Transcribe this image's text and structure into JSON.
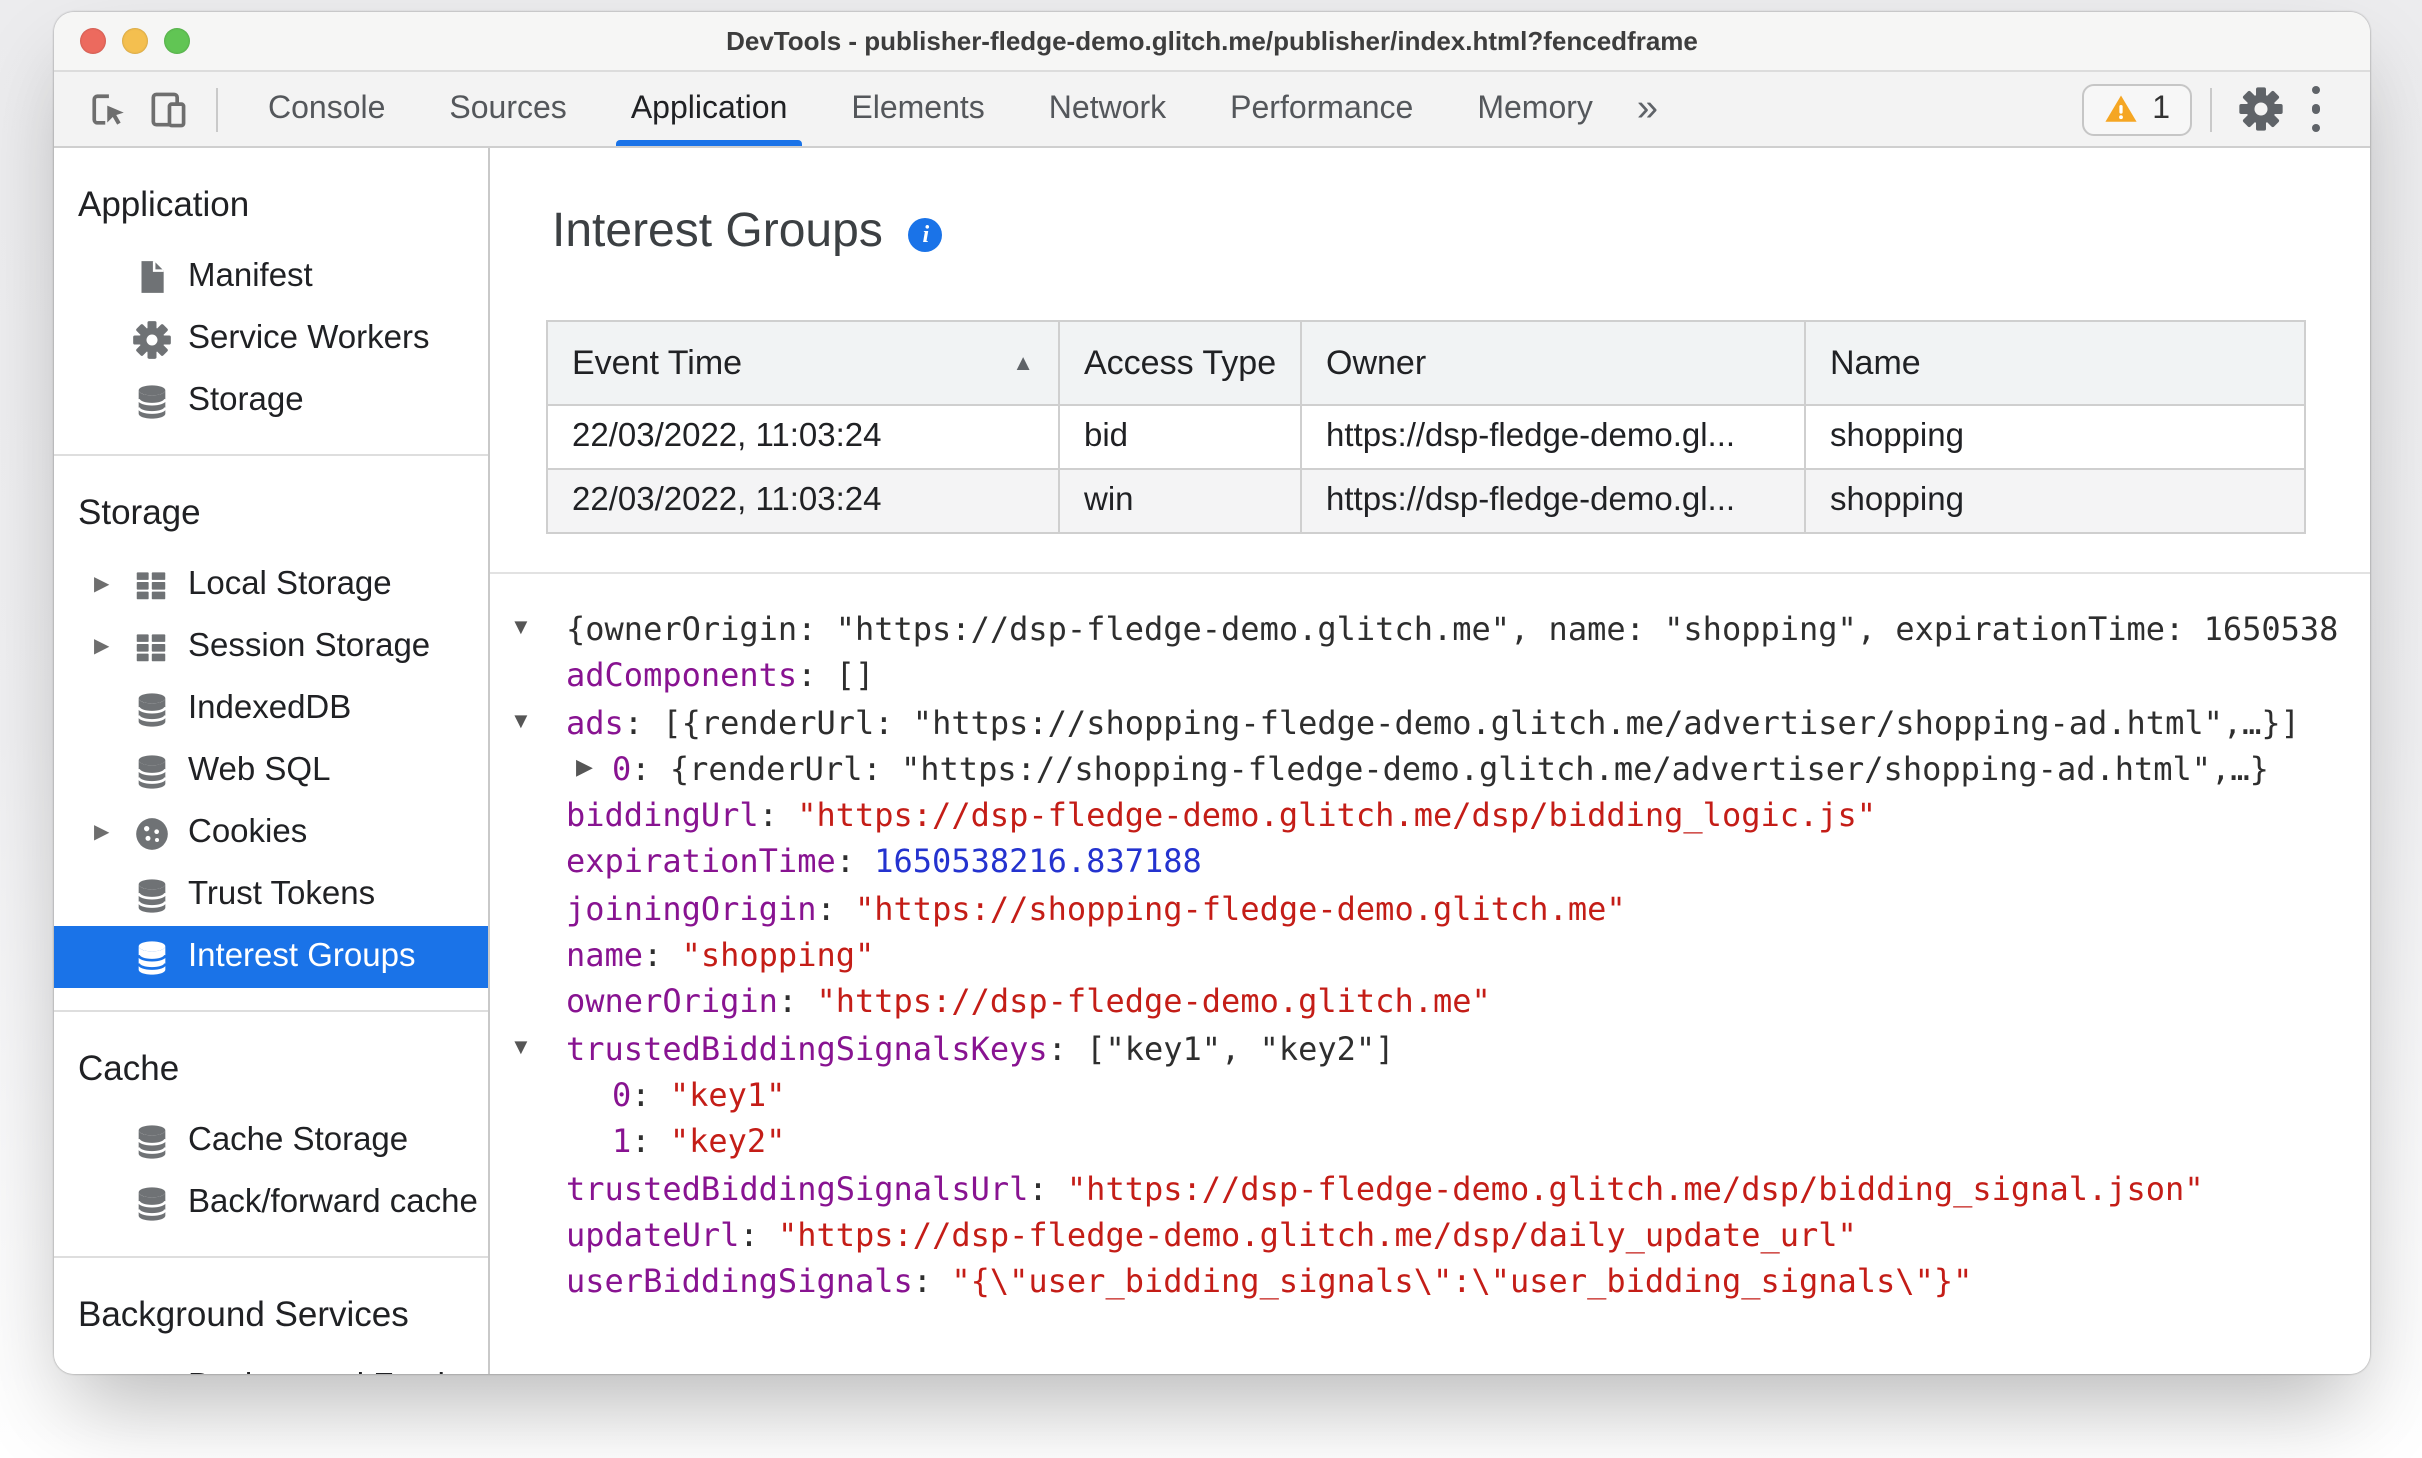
{
  "colors": {
    "accent": "#1a73e8",
    "key": "#881391",
    "string": "#c41d17",
    "number": "#2433cf",
    "warning": "#f5a623",
    "traffic_close": "#ec6a5e",
    "traffic_minimize": "#f4bf4f",
    "traffic_zoom": "#61c554"
  },
  "window": {
    "title": "DevTools - publisher-fledge-demo.glitch.me/publisher/index.html?fencedframe"
  },
  "toolbar": {
    "inspect_icon": "inspect-icon",
    "device_icon": "device-toolbar-icon",
    "tabs": [
      {
        "label": "Console",
        "active": false
      },
      {
        "label": "Sources",
        "active": false
      },
      {
        "label": "Application",
        "active": true
      },
      {
        "label": "Elements",
        "active": false
      },
      {
        "label": "Network",
        "active": false
      },
      {
        "label": "Performance",
        "active": false
      },
      {
        "label": "Memory",
        "active": false
      }
    ],
    "more_tabs_glyph": "»",
    "warning_count": "1",
    "gear_icon": "gear-icon",
    "kebab_icon": "kebab-menu-icon"
  },
  "sidebar": {
    "sections": [
      {
        "title": "Application",
        "items": [
          {
            "label": "Manifest",
            "icon": "document-icon",
            "expandable": false,
            "selected": false
          },
          {
            "label": "Service Workers",
            "icon": "gear-icon",
            "expandable": false,
            "selected": false
          },
          {
            "label": "Storage",
            "icon": "database-icon",
            "expandable": false,
            "selected": false
          }
        ]
      },
      {
        "title": "Storage",
        "items": [
          {
            "label": "Local Storage",
            "icon": "table-icon",
            "expandable": true,
            "selected": false
          },
          {
            "label": "Session Storage",
            "icon": "table-icon",
            "expandable": true,
            "selected": false
          },
          {
            "label": "IndexedDB",
            "icon": "database-icon",
            "expandable": false,
            "selected": false
          },
          {
            "label": "Web SQL",
            "icon": "database-icon",
            "expandable": false,
            "selected": false
          },
          {
            "label": "Cookies",
            "icon": "cookie-icon",
            "expandable": true,
            "selected": false
          },
          {
            "label": "Trust Tokens",
            "icon": "database-icon",
            "expandable": false,
            "selected": false
          },
          {
            "label": "Interest Groups",
            "icon": "database-icon",
            "expandable": false,
            "selected": true
          }
        ]
      },
      {
        "title": "Cache",
        "items": [
          {
            "label": "Cache Storage",
            "icon": "database-icon",
            "expandable": false,
            "selected": false
          },
          {
            "label": "Back/forward cache",
            "icon": "database-icon",
            "expandable": false,
            "selected": false
          }
        ]
      },
      {
        "title": "Background Services",
        "items": [
          {
            "label": "Background Fetch",
            "icon": "fetch-icon",
            "expandable": false,
            "selected": false
          }
        ]
      }
    ]
  },
  "main": {
    "title": "Interest Groups",
    "info_icon_glyph": "i",
    "table": {
      "columns": [
        {
          "label": "Event Time",
          "sort": "asc"
        },
        {
          "label": "Access Type",
          "sort": null
        },
        {
          "label": "Owner",
          "sort": null
        },
        {
          "label": "Name",
          "sort": null
        }
      ],
      "sort_glyph": "▲",
      "rows": [
        [
          "22/03/2022, 11:03:24",
          "bid",
          "https://dsp-fledge-demo.gl...",
          "shopping"
        ],
        [
          "22/03/2022, 11:03:24",
          "win",
          "https://dsp-fledge-demo.gl...",
          "shopping"
        ]
      ]
    },
    "tree": {
      "open_glyph": "▼",
      "closed_glyph": "▶",
      "lines": [
        {
          "level": 1,
          "expander": "open",
          "segments": [
            {
              "c": "plain",
              "t": "{ownerOrigin: \"https://dsp-fledge-demo.glitch.me\", name: \"shopping\", expirationTime: 1650538"
            }
          ]
        },
        {
          "level": 1,
          "expander": "none",
          "segments": [
            {
              "c": "key",
              "t": "adComponents"
            },
            {
              "c": "plain",
              "t": ": []"
            }
          ]
        },
        {
          "level": 1,
          "expander": "open",
          "segments": [
            {
              "c": "key",
              "t": "ads"
            },
            {
              "c": "plain",
              "t": ": [{renderUrl: \"https://shopping-fledge-demo.glitch.me/advertiser/shopping-ad.html\",…}]"
            }
          ]
        },
        {
          "level": 2,
          "expander": "closed",
          "segments": [
            {
              "c": "key",
              "t": "0"
            },
            {
              "c": "plain",
              "t": ": {renderUrl: \"https://shopping-fledge-demo.glitch.me/advertiser/shopping-ad.html\",…}"
            }
          ]
        },
        {
          "level": 1,
          "expander": "none",
          "segments": [
            {
              "c": "key",
              "t": "biddingUrl"
            },
            {
              "c": "plain",
              "t": ": "
            },
            {
              "c": "str",
              "t": "\"https://dsp-fledge-demo.glitch.me/dsp/bidding_logic.js\""
            }
          ]
        },
        {
          "level": 1,
          "expander": "none",
          "segments": [
            {
              "c": "key",
              "t": "expirationTime"
            },
            {
              "c": "plain",
              "t": ": "
            },
            {
              "c": "num",
              "t": "1650538216.837188"
            }
          ]
        },
        {
          "level": 1,
          "expander": "none",
          "segments": [
            {
              "c": "key",
              "t": "joiningOrigin"
            },
            {
              "c": "plain",
              "t": ": "
            },
            {
              "c": "str",
              "t": "\"https://shopping-fledge-demo.glitch.me\""
            }
          ]
        },
        {
          "level": 1,
          "expander": "none",
          "segments": [
            {
              "c": "key",
              "t": "name"
            },
            {
              "c": "plain",
              "t": ": "
            },
            {
              "c": "str",
              "t": "\"shopping\""
            }
          ]
        },
        {
          "level": 1,
          "expander": "none",
          "segments": [
            {
              "c": "key",
              "t": "ownerOrigin"
            },
            {
              "c": "plain",
              "t": ": "
            },
            {
              "c": "str",
              "t": "\"https://dsp-fledge-demo.glitch.me\""
            }
          ]
        },
        {
          "level": 1,
          "expander": "open",
          "segments": [
            {
              "c": "key",
              "t": "trustedBiddingSignalsKeys"
            },
            {
              "c": "plain",
              "t": ": [\"key1\", \"key2\"]"
            }
          ]
        },
        {
          "level": 2,
          "expander": "none",
          "segments": [
            {
              "c": "key",
              "t": "0"
            },
            {
              "c": "plain",
              "t": ": "
            },
            {
              "c": "str",
              "t": "\"key1\""
            }
          ]
        },
        {
          "level": 2,
          "expander": "none",
          "segments": [
            {
              "c": "key",
              "t": "1"
            },
            {
              "c": "plain",
              "t": ": "
            },
            {
              "c": "str",
              "t": "\"key2\""
            }
          ]
        },
        {
          "level": 1,
          "expander": "none",
          "segments": [
            {
              "c": "key",
              "t": "trustedBiddingSignalsUrl"
            },
            {
              "c": "plain",
              "t": ": "
            },
            {
              "c": "str",
              "t": "\"https://dsp-fledge-demo.glitch.me/dsp/bidding_signal.json\""
            }
          ]
        },
        {
          "level": 1,
          "expander": "none",
          "segments": [
            {
              "c": "key",
              "t": "updateUrl"
            },
            {
              "c": "plain",
              "t": ": "
            },
            {
              "c": "str",
              "t": "\"https://dsp-fledge-demo.glitch.me/dsp/daily_update_url\""
            }
          ]
        },
        {
          "level": 1,
          "expander": "none",
          "segments": [
            {
              "c": "key",
              "t": "userBiddingSignals"
            },
            {
              "c": "plain",
              "t": ": "
            },
            {
              "c": "str",
              "t": "\"{\\\"user_bidding_signals\\\":\\\"user_bidding_signals\\\"}\""
            }
          ]
        }
      ]
    }
  }
}
